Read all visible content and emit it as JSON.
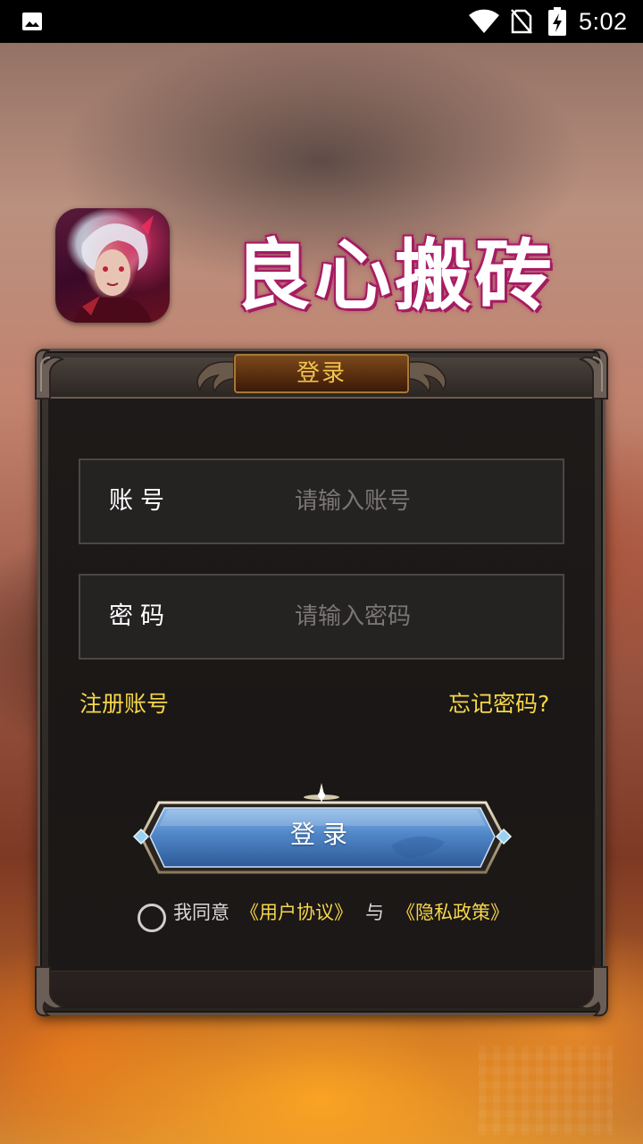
{
  "status_bar": {
    "time": "5:02",
    "icons": [
      "image-icon",
      "wifi-icon",
      "no-sim-icon",
      "battery-charging-icon"
    ]
  },
  "header": {
    "app_title": "良心搬砖",
    "app_icon": "game-character-app-icon"
  },
  "login_panel": {
    "title": "登录",
    "account": {
      "label": "账号",
      "placeholder": "请输入账号",
      "value": ""
    },
    "password": {
      "label": "密码",
      "placeholder": "请输入密码",
      "value": ""
    },
    "register_link": "注册账号",
    "forgot_link": "忘记密码?",
    "login_button": "登录",
    "agreement": {
      "checked": false,
      "lead": "我同意",
      "user_agreement": "《用户协议》",
      "and": "与",
      "privacy_policy": "《隐私政策》"
    }
  },
  "colors": {
    "accent_yellow": "#f6d64a",
    "title_gold": "#f2c44e",
    "button_blue": "#4f86c8",
    "panel_dark": "#1c1817",
    "title_outline_magenta": "#9a1a5a"
  }
}
